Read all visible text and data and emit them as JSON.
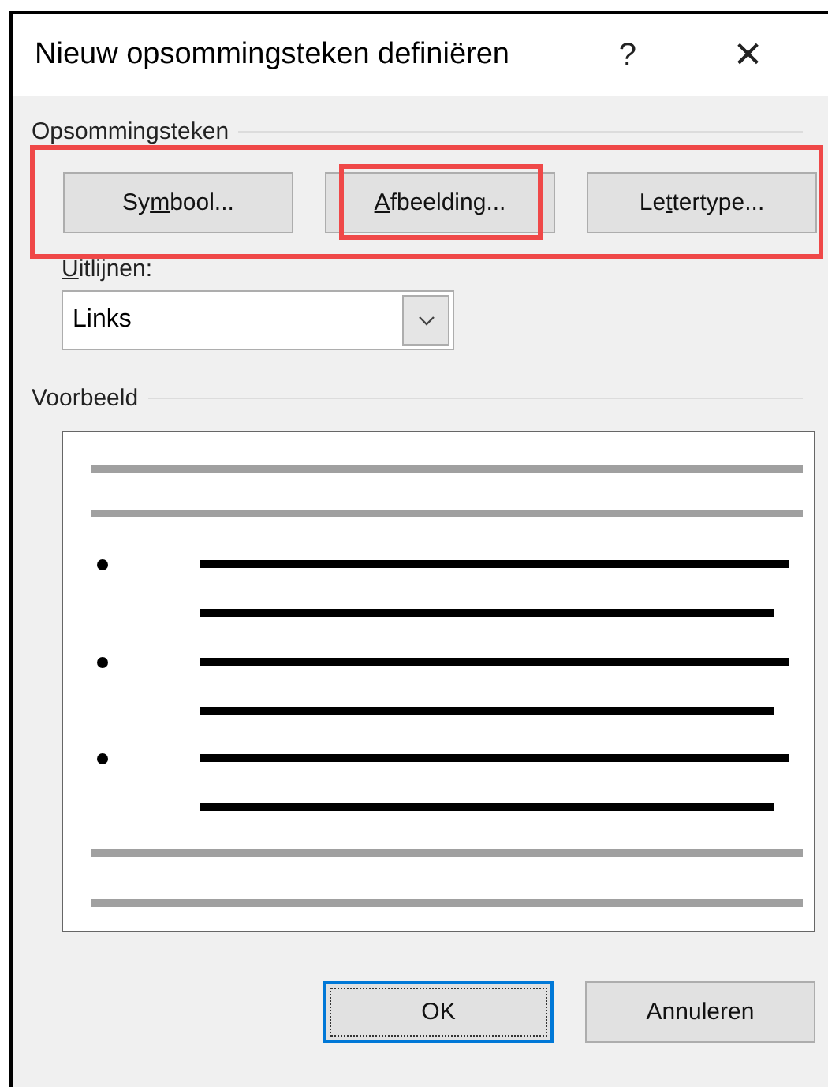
{
  "window": {
    "title": "Nieuw opsommingsteken definiëren",
    "help": "?",
    "close": "×"
  },
  "bullet_group": {
    "title": "Opsommingsteken",
    "highlighted": true,
    "buttons": [
      {
        "before": "Sy",
        "key": "m",
        "after": "bool...",
        "highlighted": false
      },
      {
        "key": "A",
        "after": "fbeelding...",
        "highlighted": true
      },
      {
        "before": "Le",
        "key": "t",
        "after": "tertype...",
        "highlighted": false
      }
    ]
  },
  "alignment": {
    "key": "U",
    "after": "itlijnen:",
    "value": "Links"
  },
  "preview": {
    "title": "Voorbeeld"
  },
  "buttons": [
    {
      "label": "OK",
      "focused": true
    },
    {
      "label": "Annuleren",
      "focused": false
    }
  ]
}
